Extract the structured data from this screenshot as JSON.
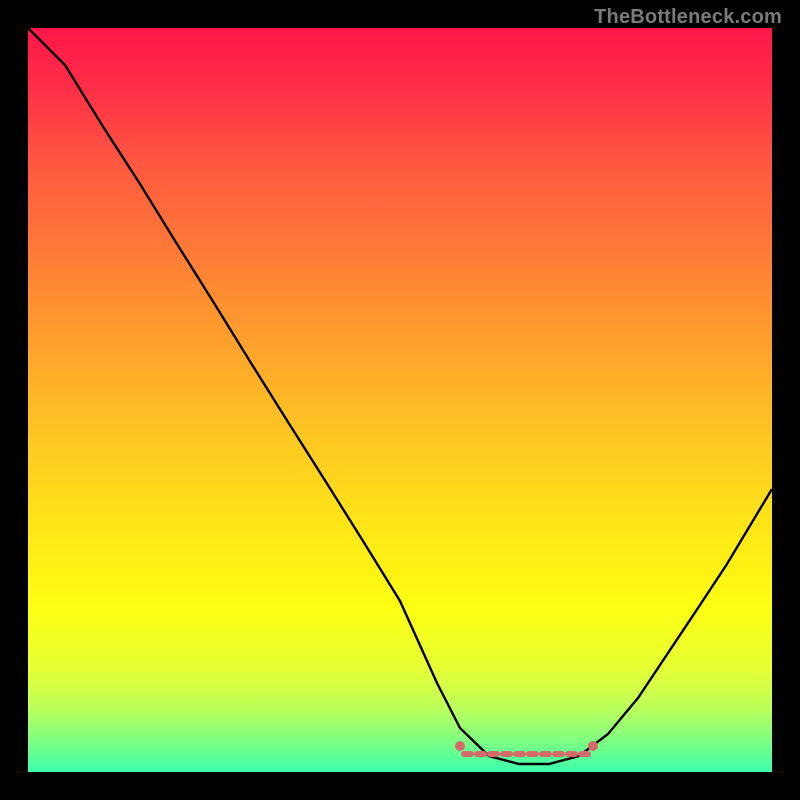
{
  "watermark": "TheBottleneck.com",
  "chart_data": {
    "type": "line",
    "title": "",
    "xlabel": "",
    "ylabel": "",
    "xlim": [
      0,
      1
    ],
    "ylim": [
      0,
      1
    ],
    "series": [
      {
        "name": "bottleneck-curve",
        "x": [
          0.0,
          0.05,
          0.1,
          0.15,
          0.2,
          0.25,
          0.3,
          0.35,
          0.4,
          0.45,
          0.5,
          0.55,
          0.58,
          0.62,
          0.66,
          0.7,
          0.74,
          0.78,
          0.82,
          0.86,
          0.9,
          0.94,
          1.0
        ],
        "values": [
          1.0,
          0.95,
          0.87,
          0.79,
          0.71,
          0.63,
          0.55,
          0.47,
          0.39,
          0.31,
          0.23,
          0.12,
          0.06,
          0.02,
          0.01,
          0.01,
          0.02,
          0.05,
          0.1,
          0.16,
          0.22,
          0.28,
          0.38
        ]
      }
    ],
    "valley_marker": {
      "name": "valley-range",
      "x_start": 0.58,
      "x_end": 0.76,
      "y": 0.035,
      "color": "#d46a6a"
    },
    "background_gradient": {
      "top": "#ff1649",
      "bottom": "#3cffad"
    }
  }
}
